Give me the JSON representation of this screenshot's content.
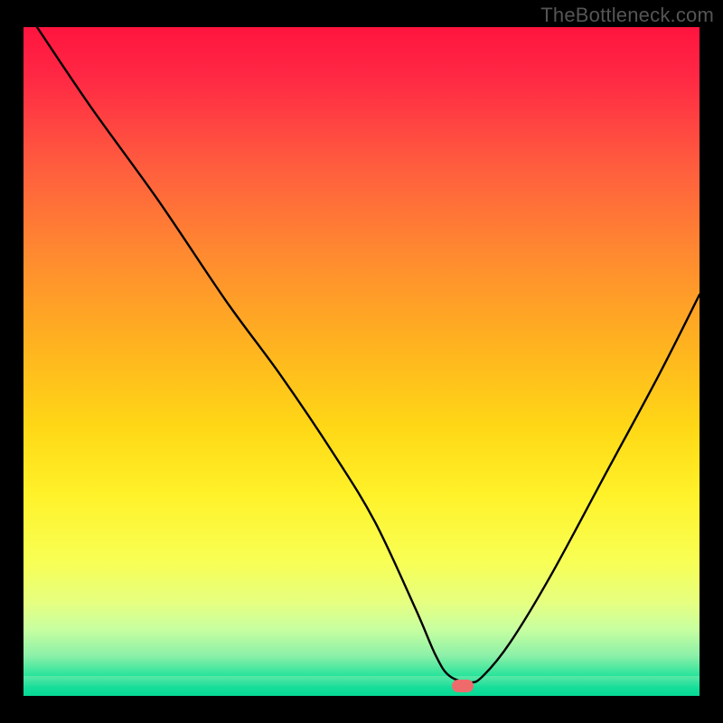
{
  "watermark": "TheBottleneck.com",
  "chart_data": {
    "type": "line",
    "title": "",
    "xlabel": "",
    "ylabel": "",
    "xlim": [
      0,
      100
    ],
    "ylim": [
      0,
      100
    ],
    "grid": false,
    "legend": false,
    "background": "vertical-gradient",
    "gradient_colors": {
      "top": "#ff143f",
      "mid": "#ffd000",
      "bottom": "#05d994"
    },
    "series": [
      {
        "name": "bottleneck-curve",
        "color": "#000000",
        "x": [
          2,
          10,
          20,
          30,
          38,
          46,
          52,
          58,
          61,
          63,
          66,
          68,
          72,
          78,
          86,
          94,
          100
        ],
        "y": [
          100,
          88,
          74,
          59,
          48,
          36,
          26,
          13,
          6,
          3,
          2,
          3,
          8,
          18,
          33,
          48,
          60
        ]
      }
    ],
    "annotations": [
      {
        "name": "optimal-marker",
        "type": "pill",
        "color": "#ef6b6b",
        "x": 65,
        "y": 1.5
      }
    ]
  }
}
